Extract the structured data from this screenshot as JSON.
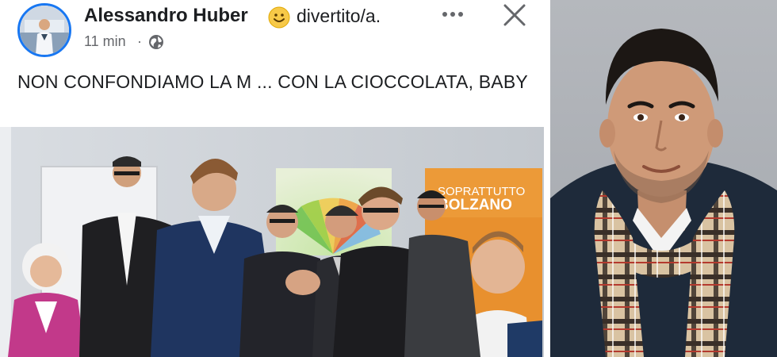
{
  "post": {
    "author": "Alessandro Huber",
    "feeling": "divertito/a.",
    "time": "11 min",
    "separator": "·",
    "text": "NON CONFONDIAMO LA M ... CON LA CIOCCOLATA, BABY",
    "icons": {
      "feeling": "smiley-emoji-icon",
      "audience": "globe-icon",
      "more": "more-horizontal-icon",
      "close": "close-icon"
    }
  },
  "photo": {
    "poster_line1": "SOPRATTUTTO",
    "poster_line2": "BOLZANO"
  },
  "colors": {
    "link_blue": "#1877f2",
    "text": "#1c1e21",
    "secondary": "#65676b"
  }
}
